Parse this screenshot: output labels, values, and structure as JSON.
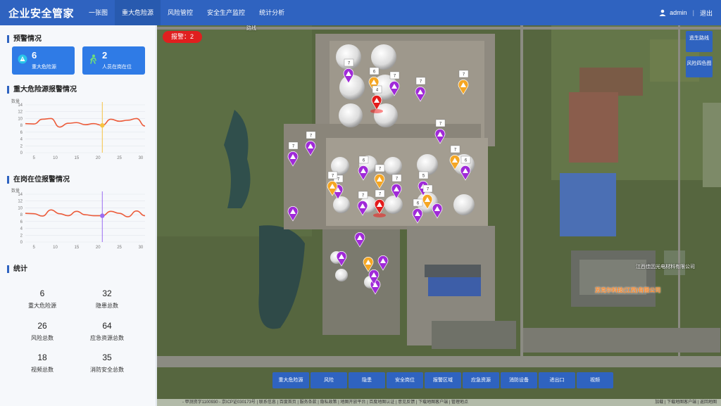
{
  "app": {
    "title": "企业安全管家"
  },
  "nav": [
    {
      "label": "一张图",
      "active": false
    },
    {
      "label": "重大危险源",
      "active": true
    },
    {
      "label": "风险管控",
      "active": false
    },
    {
      "label": "安全生产监控",
      "active": false
    },
    {
      "label": "统计分析",
      "active": false
    }
  ],
  "user": {
    "name": "admin",
    "logout": "退出",
    "icon": "user-icon"
  },
  "sidebar": {
    "warning": {
      "title": "预警情况",
      "cards": [
        {
          "value": "6",
          "label": "重大危险源",
          "icon": "hazard-icon"
        },
        {
          "value": "2",
          "label": "人员在岗在位",
          "icon": "person-icon"
        }
      ]
    },
    "hazard_chart_title": "重大危险源报警情况",
    "onduty_chart_title": "在岗在位报警情况",
    "stats": {
      "title": "统计",
      "items": [
        {
          "value": "6",
          "label": "重大危险源"
        },
        {
          "value": "32",
          "label": "隐患总数"
        },
        {
          "value": "26",
          "label": "风险总数"
        },
        {
          "value": "64",
          "label": "应急资源总数"
        },
        {
          "value": "18",
          "label": "视频总数"
        },
        {
          "value": "35",
          "label": "消防安全总数"
        }
      ]
    }
  },
  "chart_data": [
    {
      "type": "line",
      "ylabel": "数量",
      "ylim": [
        0,
        14
      ],
      "yticks": [
        "0",
        "2",
        "4",
        "6",
        "8",
        "10",
        "12",
        "14"
      ],
      "xlim": [
        3,
        31
      ],
      "xticks": [
        "5",
        "10",
        "15",
        "20",
        "25",
        "30"
      ],
      "x": [
        3,
        5,
        7,
        9,
        11,
        13,
        15,
        17,
        19,
        21,
        23,
        25,
        27,
        29,
        31
      ],
      "values": [
        8.5,
        8.4,
        9.8,
        10.0,
        7.5,
        8.6,
        8.8,
        8.2,
        8.5,
        8.0,
        9.8,
        9.2,
        9.5,
        10.0,
        7.8
      ],
      "color": "#ec5b3a",
      "marker": {
        "x": 21,
        "value": 8.0,
        "color": "#f6c342"
      },
      "grid": true
    },
    {
      "type": "line",
      "ylabel": "数量",
      "ylim": [
        0,
        14
      ],
      "yticks": [
        "0",
        "2",
        "4",
        "6",
        "8",
        "10",
        "12",
        "14"
      ],
      "xlim": [
        3,
        31
      ],
      "xticks": [
        "5",
        "10",
        "15",
        "20",
        "25",
        "30"
      ],
      "x": [
        3,
        5,
        7,
        9,
        11,
        13,
        15,
        17,
        19,
        21,
        23,
        25,
        27,
        29,
        31
      ],
      "values": [
        8.4,
        8.3,
        7.6,
        9.4,
        8.3,
        7.7,
        9.0,
        8.0,
        7.7,
        7.7,
        9.0,
        8.4,
        7.4,
        9.1,
        7.7
      ],
      "color": "#ec5b3a",
      "marker": {
        "x": 21,
        "value": 7.7,
        "color": "#9b6bf2"
      },
      "grid": true
    }
  ],
  "map": {
    "alarm_label": "报警：2",
    "side_buttons": [
      "逃生路线",
      "风险四色图"
    ],
    "bottom_buttons": [
      "重大危险源",
      "风险",
      "隐患",
      "安全岗位",
      "报警区域",
      "应急资源",
      "消防设备",
      "进出口",
      "视频"
    ],
    "labels": {
      "company_a": "江西佳因光电材料有限公司",
      "company_b": "苏克尔科技(江西)有限公司",
      "road_top": "路线"
    },
    "footer_left": "- 甲测资字1100930 - 京ICP证030173号 | 联系信息 | 百度首页 | 服务条款 | 隐私政策 | 地图开放平台 | 百度地图认证 | 意见反馈 | 下载地图客户端 | 管理地点",
    "footer_right": "加载 | 下载地图客户端 | 返回地图",
    "marker_badges": [
      "7",
      "6",
      "7",
      "7",
      "7",
      "4",
      "7",
      "7",
      "7",
      "6",
      "7",
      "7",
      "5",
      "7",
      "6",
      "7",
      "7",
      "7",
      "7",
      "6",
      "7"
    ]
  }
}
